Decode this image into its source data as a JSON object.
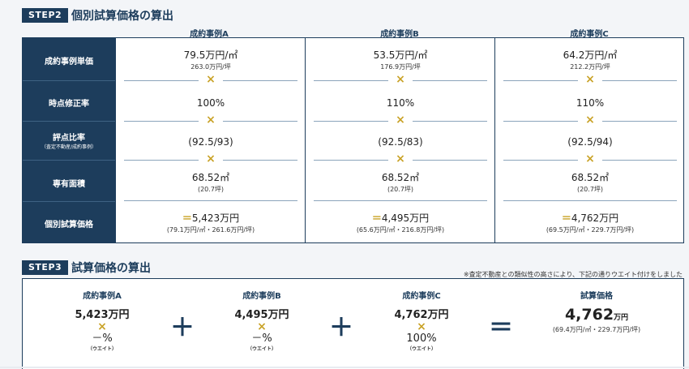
{
  "step2": {
    "badge": "STEP2",
    "title": "個別試算価格の算出",
    "row_labels": [
      "成約事例単価",
      "時点修正率",
      "評点比率",
      "専有面積",
      "個別試算価格"
    ],
    "row_sublabel_ratio": "（査定不動産/成約事例）",
    "multiply_symbol": "×",
    "equals_symbol": "＝",
    "cases": [
      {
        "name": "成約事例A",
        "unit_price": "79.5万円/㎡",
        "unit_price_tsubo": "263.0万円/坪",
        "time_rate": "100%",
        "ratio": "(92.5/93)",
        "area": "68.52㎡",
        "area_tsubo": "(20.7坪)",
        "price": "5,423万円",
        "price_detail": "(79.1万円/㎡・261.6万円/坪)"
      },
      {
        "name": "成約事例B",
        "unit_price": "53.5万円/㎡",
        "unit_price_tsubo": "176.9万円/坪",
        "time_rate": "110%",
        "ratio": "(92.5/83)",
        "area": "68.52㎡",
        "area_tsubo": "(20.7坪)",
        "price": "4,495万円",
        "price_detail": "(65.6万円/㎡・216.8万円/坪)"
      },
      {
        "name": "成約事例C",
        "unit_price": "64.2万円/㎡",
        "unit_price_tsubo": "212.2万円/坪",
        "time_rate": "110%",
        "ratio": "(92.5/94)",
        "area": "68.52㎡",
        "area_tsubo": "(20.7坪)",
        "price": "4,762万円",
        "price_detail": "(69.5万円/㎡・229.7万円/坪)"
      }
    ]
  },
  "step3": {
    "badge": "STEP3",
    "title": "試算価格の算出",
    "note": "※査定不動産との類似性の高さにより、下記の通りウエイト付けをしました",
    "plus_symbol": "＋",
    "equals_symbol": "＝",
    "multiply_symbol": "×",
    "weight_label": "（ウエイト）",
    "items": [
      {
        "name": "成約事例A",
        "value": "5,423万円",
        "weight": "－%"
      },
      {
        "name": "成約事例B",
        "value": "4,495万円",
        "weight": "－%"
      },
      {
        "name": "成約事例C",
        "value": "4,762万円",
        "weight": "100%"
      }
    ],
    "result": {
      "label": "試算価格",
      "value": "4,762",
      "unit": "万円",
      "detail": "(69.4万円/㎡・229.7万円/坪)"
    }
  },
  "colors": {
    "navy": "#1d3d5c",
    "gold": "#c9a227"
  }
}
